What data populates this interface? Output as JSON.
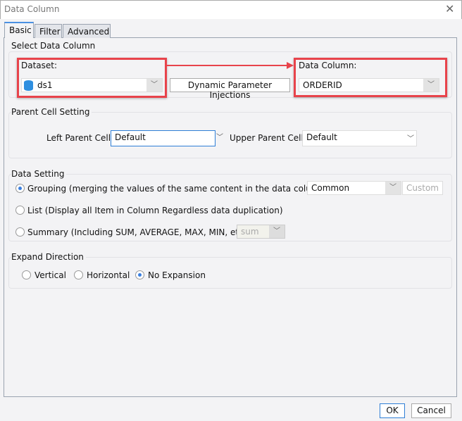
{
  "window": {
    "title": "Data Column"
  },
  "tabs": [
    {
      "label": "Basic"
    },
    {
      "label": "Filter"
    },
    {
      "label": "Advanced"
    }
  ],
  "select_data_column": {
    "title": "Select Data Column",
    "dataset_label": "Dataset:",
    "dataset_value": "ds1",
    "dynamic_button": "Dynamic Parameter Injections",
    "column_label": "Data Column:",
    "column_value": "ORDERID"
  },
  "parent_cell": {
    "title": "Parent Cell Setting",
    "left_label": "Left Parent Cell:",
    "left_value": "Default",
    "upper_label": "Upper Parent Cell:",
    "upper_value": "Default"
  },
  "data_setting": {
    "title": "Data Setting",
    "grouping": "Grouping (merging the values of the same content in the data column)",
    "grouping_value": "Common",
    "custom_button": "Custom",
    "list": "List (Display all Item in Column Regardless data duplication)",
    "summary": "Summary (Including SUM, AVERAGE, MAX, MIN, etc.)",
    "summary_value": "sum",
    "selected": "grouping"
  },
  "expand": {
    "title": "Expand Direction",
    "vertical": "Vertical",
    "horizontal": "Horizontal",
    "none": "No Expansion",
    "selected": "none"
  },
  "footer": {
    "ok": "OK",
    "cancel": "Cancel"
  },
  "colors": {
    "highlight": "#e8434b",
    "accent": "#3a7fe0"
  }
}
